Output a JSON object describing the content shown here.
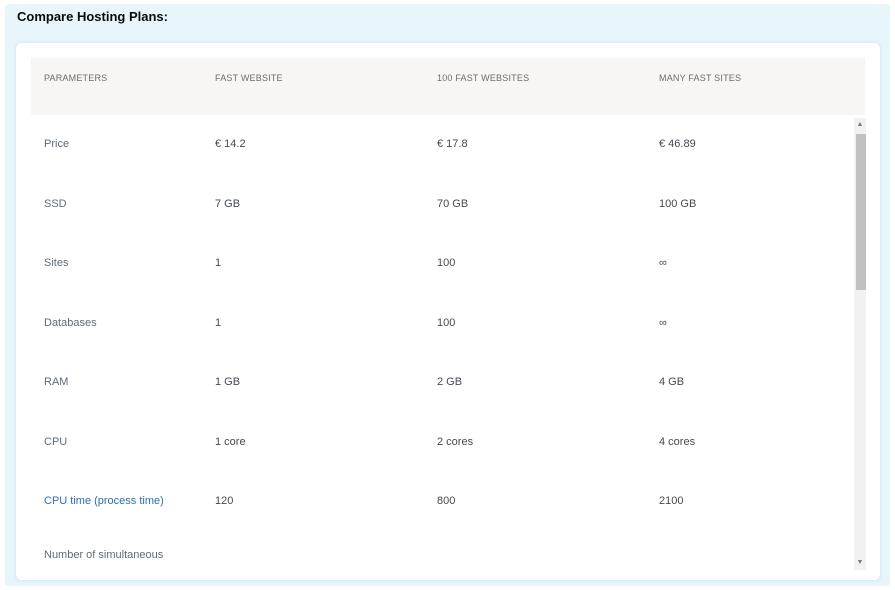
{
  "section_title": "Compare Hosting Plans:",
  "table": {
    "headers": [
      "PARAMETERS",
      "FAST WEBSITE",
      "100 FAST WEBSITES",
      "MANY FAST SITES"
    ],
    "rows": [
      {
        "param": "Price",
        "v1": "€ 14.2",
        "v2": "€ 17.8",
        "v3": "€ 46.89"
      },
      {
        "param": "SSD",
        "v1": "7 GB",
        "v2": "70 GB",
        "v3": "100 GB"
      },
      {
        "param": "Sites",
        "v1": "1",
        "v2": "100",
        "v3": "∞"
      },
      {
        "param": "Databases",
        "v1": "1",
        "v2": "100",
        "v3": "∞"
      },
      {
        "param": "RAM",
        "v1": "1 GB",
        "v2": "2 GB",
        "v3": "4 GB"
      },
      {
        "param": "CPU",
        "v1": "1 core",
        "v2": "2 cores",
        "v3": "4 cores"
      },
      {
        "param": "CPU time (process time)",
        "v1": "120",
        "v2": "800",
        "v3": "2100"
      },
      {
        "param": "Number of simultaneous",
        "v1": "",
        "v2": "",
        "v3": ""
      }
    ]
  },
  "scrollbar": {
    "up_arrow": "▲",
    "down_arrow": "▼"
  },
  "colors": {
    "page_bg": "#e8f6fc",
    "header_bg": "#f7f6f4",
    "link": "#2f6fb0"
  }
}
